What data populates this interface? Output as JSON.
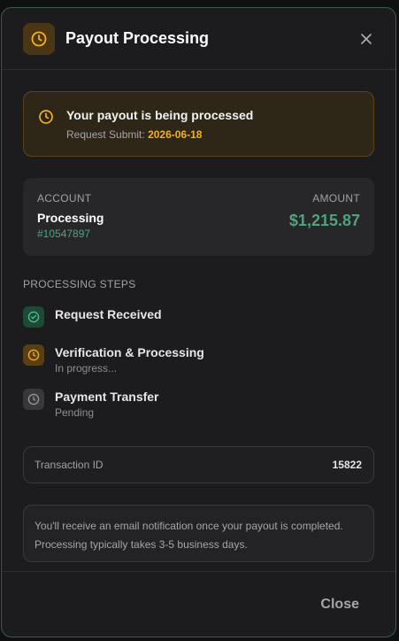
{
  "header": {
    "title": "Payout Processing",
    "icon": "clock-icon",
    "close_icon": "close-icon"
  },
  "banner": {
    "title": "Your payout is being processed",
    "submit_label": "Request Submit:",
    "submit_date": "2026-06-18",
    "icon": "clock-icon"
  },
  "account": {
    "account_label": "ACCOUNT",
    "amount_label": "AMOUNT",
    "name": "Processing",
    "number": "#10547897",
    "amount": "$1,215.87"
  },
  "steps": {
    "title": "PROCESSING STEPS",
    "items": [
      {
        "title": "Request Received",
        "subtitle": "",
        "status": "complete",
        "icon": "check-circle-icon"
      },
      {
        "title": "Verification & Processing",
        "subtitle": "In progress...",
        "status": "in-progress",
        "icon": "clock-icon"
      },
      {
        "title": "Payment Transfer",
        "subtitle": "Pending",
        "status": "pending",
        "icon": "clock-icon"
      }
    ]
  },
  "transaction": {
    "label": "Transaction ID",
    "value": "15822"
  },
  "note": {
    "text": "You'll receive an email notification once your payout is completed. Processing typically takes 3-5 business days."
  },
  "footer": {
    "close_label": "Close"
  },
  "colors": {
    "accent_orange": "#f4b023",
    "accent_green": "#4fa27d",
    "border_green": "#3c5a4c"
  }
}
